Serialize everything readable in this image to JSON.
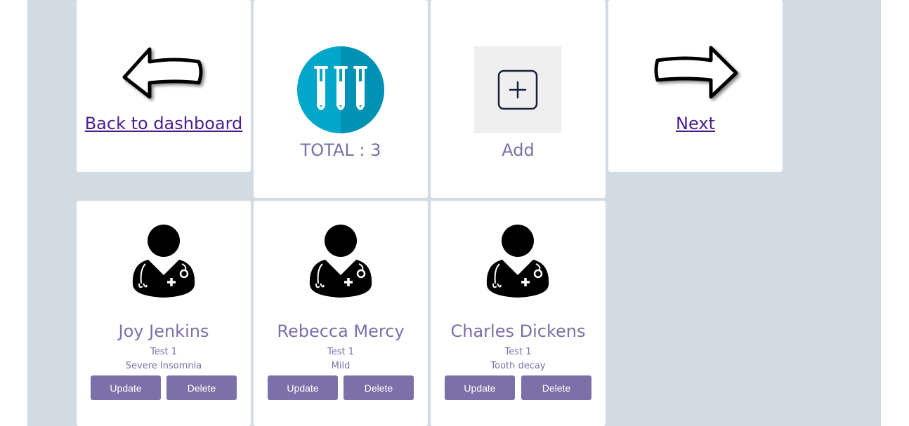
{
  "nav": {
    "back_label": "Back to dashboard",
    "next_label": "Next"
  },
  "summary": {
    "total_label": "TOTAL : 3",
    "add_label": "Add"
  },
  "patients": [
    {
      "name": "Joy Jenkins",
      "test": "Test 1",
      "condition": "Severe Insomnia",
      "update_label": "Update",
      "delete_label": "Delete"
    },
    {
      "name": "Rebecca Mercy",
      "test": "Test 1",
      "condition": "Mild",
      "update_label": "Update",
      "delete_label": "Delete"
    },
    {
      "name": "Charles Dickens",
      "test": "Test 1",
      "condition": "Tooth decay",
      "update_label": "Update",
      "delete_label": "Delete"
    }
  ],
  "colors": {
    "background": "#d2dae2",
    "card": "#ffffff",
    "accent_text": "#7c6fa8",
    "button": "#7c70a8",
    "link": "#4a1d8f",
    "tube_circle": "#00a7c9"
  },
  "icons": {
    "back": "left-arrow-icon",
    "next": "right-arrow-icon",
    "total": "test-tubes-icon",
    "add": "plus-square-icon",
    "patient": "doctor-stethoscope-icon"
  }
}
